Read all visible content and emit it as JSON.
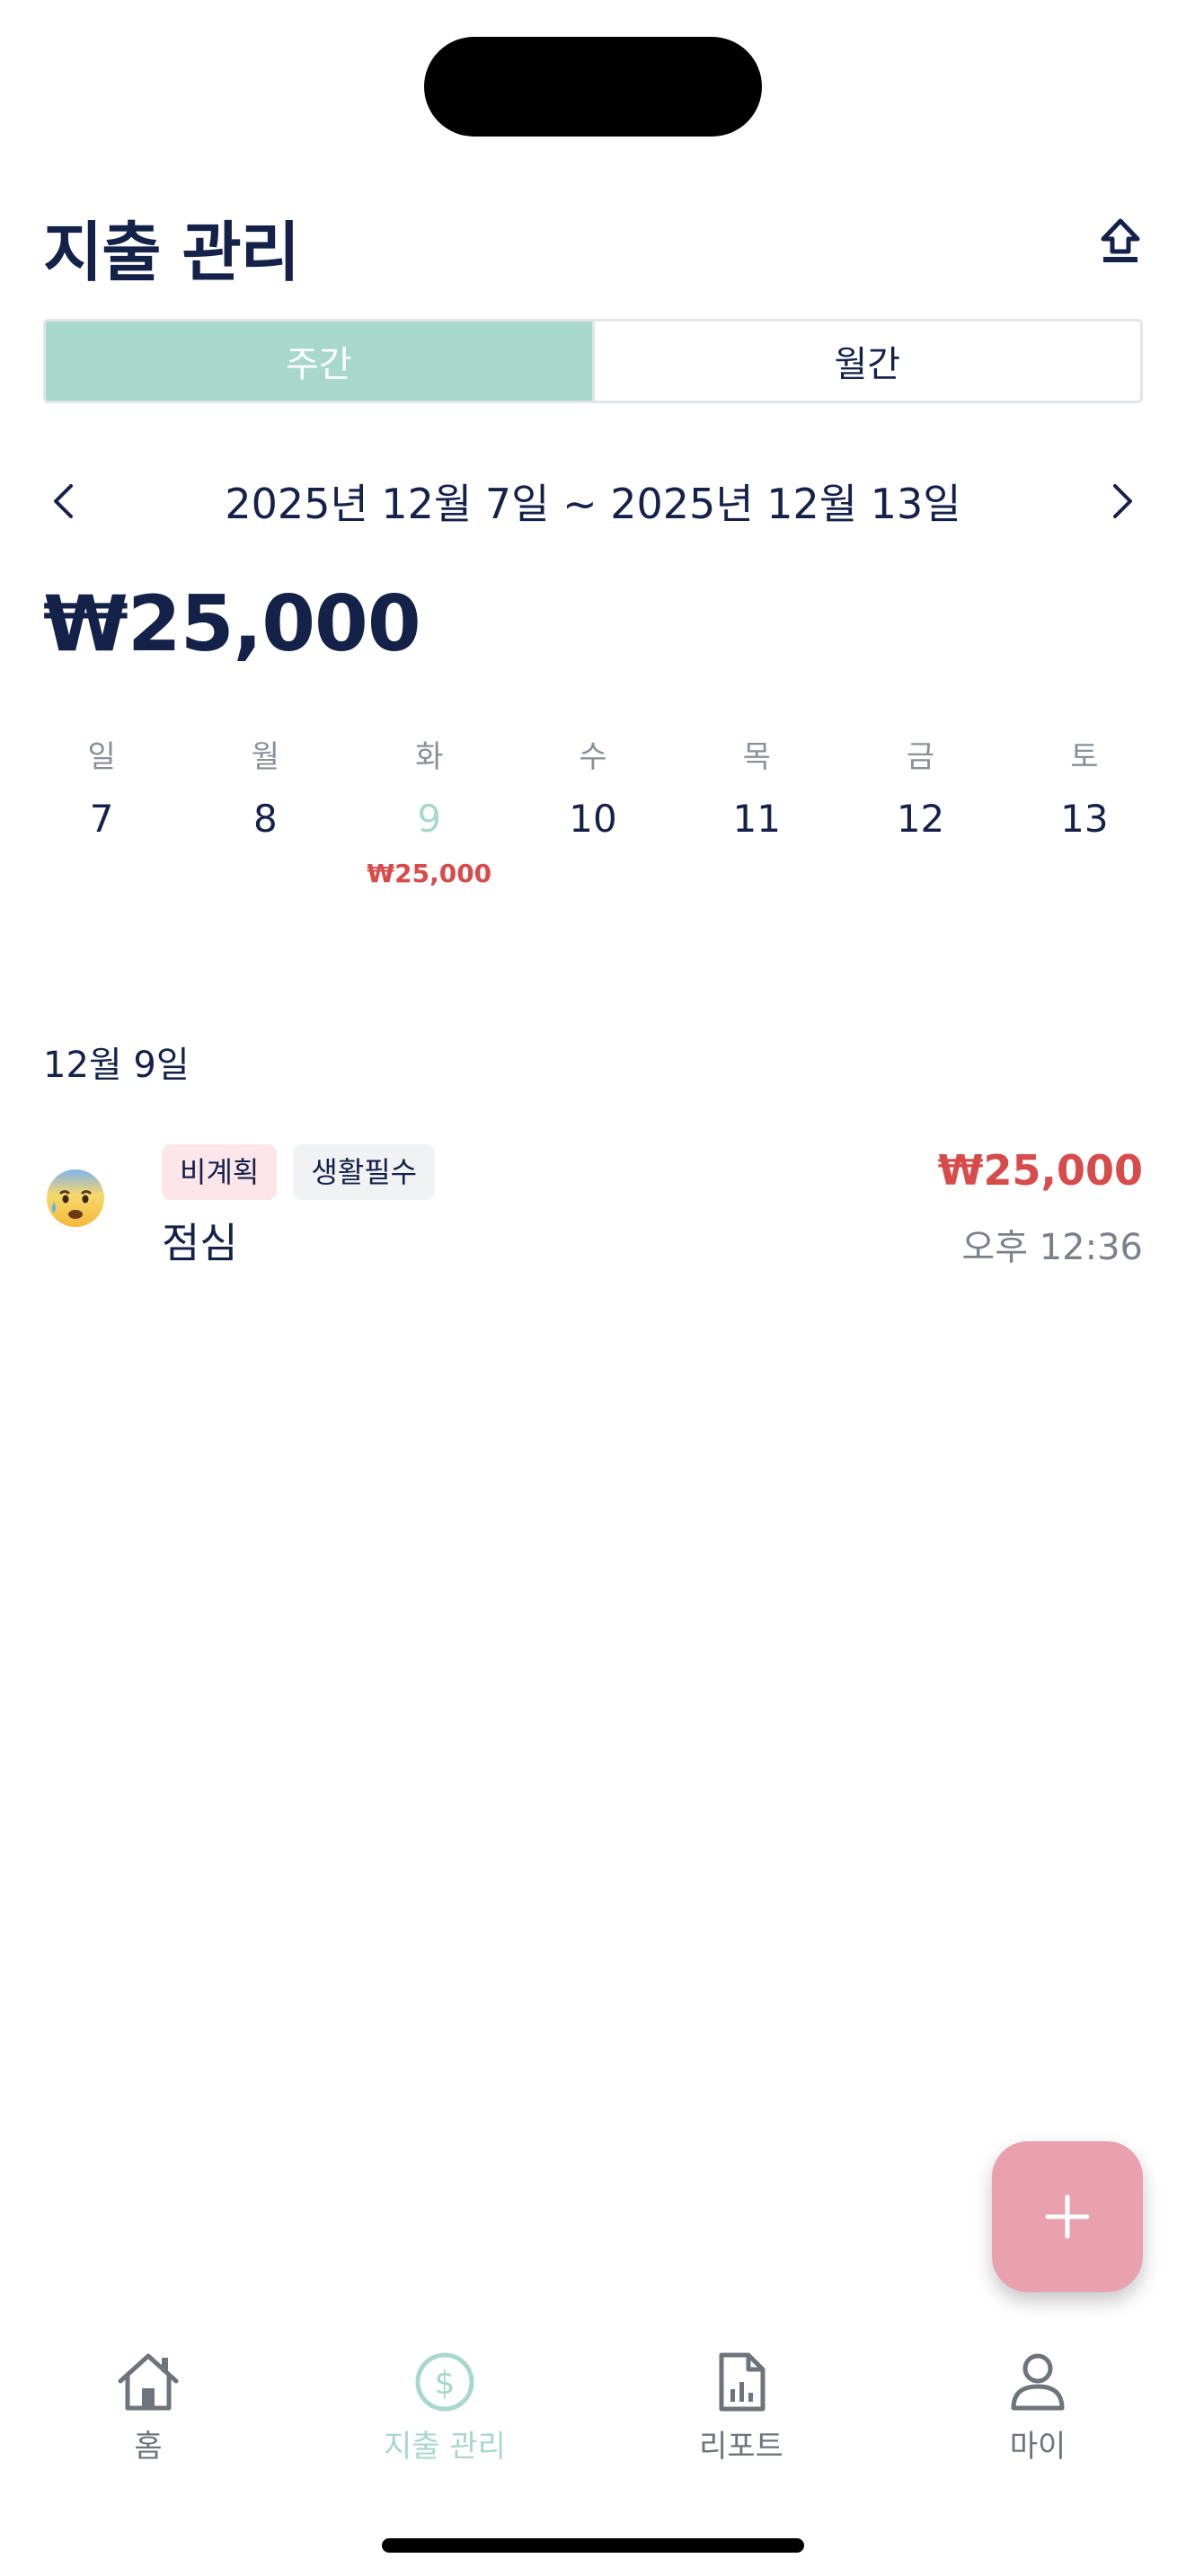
{
  "header": {
    "title": "지출 관리"
  },
  "segment": {
    "weekly": "주간",
    "monthly": "월간",
    "selected": "weekly"
  },
  "range": {
    "text": "2025년 12월 7일 ~ 2025년 12월 13일"
  },
  "total": "₩25,000",
  "week": {
    "days": [
      {
        "label": "일",
        "num": "7",
        "amount": ""
      },
      {
        "label": "월",
        "num": "8",
        "amount": ""
      },
      {
        "label": "화",
        "num": "9",
        "amount": "₩25,000"
      },
      {
        "label": "수",
        "num": "10",
        "amount": ""
      },
      {
        "label": "목",
        "num": "11",
        "amount": ""
      },
      {
        "label": "금",
        "num": "12",
        "amount": ""
      },
      {
        "label": "토",
        "num": "13",
        "amount": ""
      }
    ]
  },
  "list": {
    "date": "12월 9일",
    "entries": [
      {
        "emoji": "anxious-sweat-face-icon",
        "tags": [
          "비계획",
          "생활필수"
        ],
        "name": "점심",
        "amount": "₩25,000",
        "time": "오후 12:36"
      }
    ]
  },
  "tabbar": {
    "items": [
      {
        "label": "홈",
        "icon": "home-icon"
      },
      {
        "label": "지출 관리",
        "icon": "dollar-circle-icon"
      },
      {
        "label": "리포트",
        "icon": "report-document-icon"
      },
      {
        "label": "마이",
        "icon": "user-icon"
      }
    ],
    "active": 1
  },
  "colors": {
    "accent": "#a8d8cb",
    "navy": "#14224a",
    "expense_red": "#d84b4b",
    "fab_pink": "#e9a1b0",
    "tag_pink": "#fde6ea",
    "tag_gray": "#f1f2f4"
  }
}
